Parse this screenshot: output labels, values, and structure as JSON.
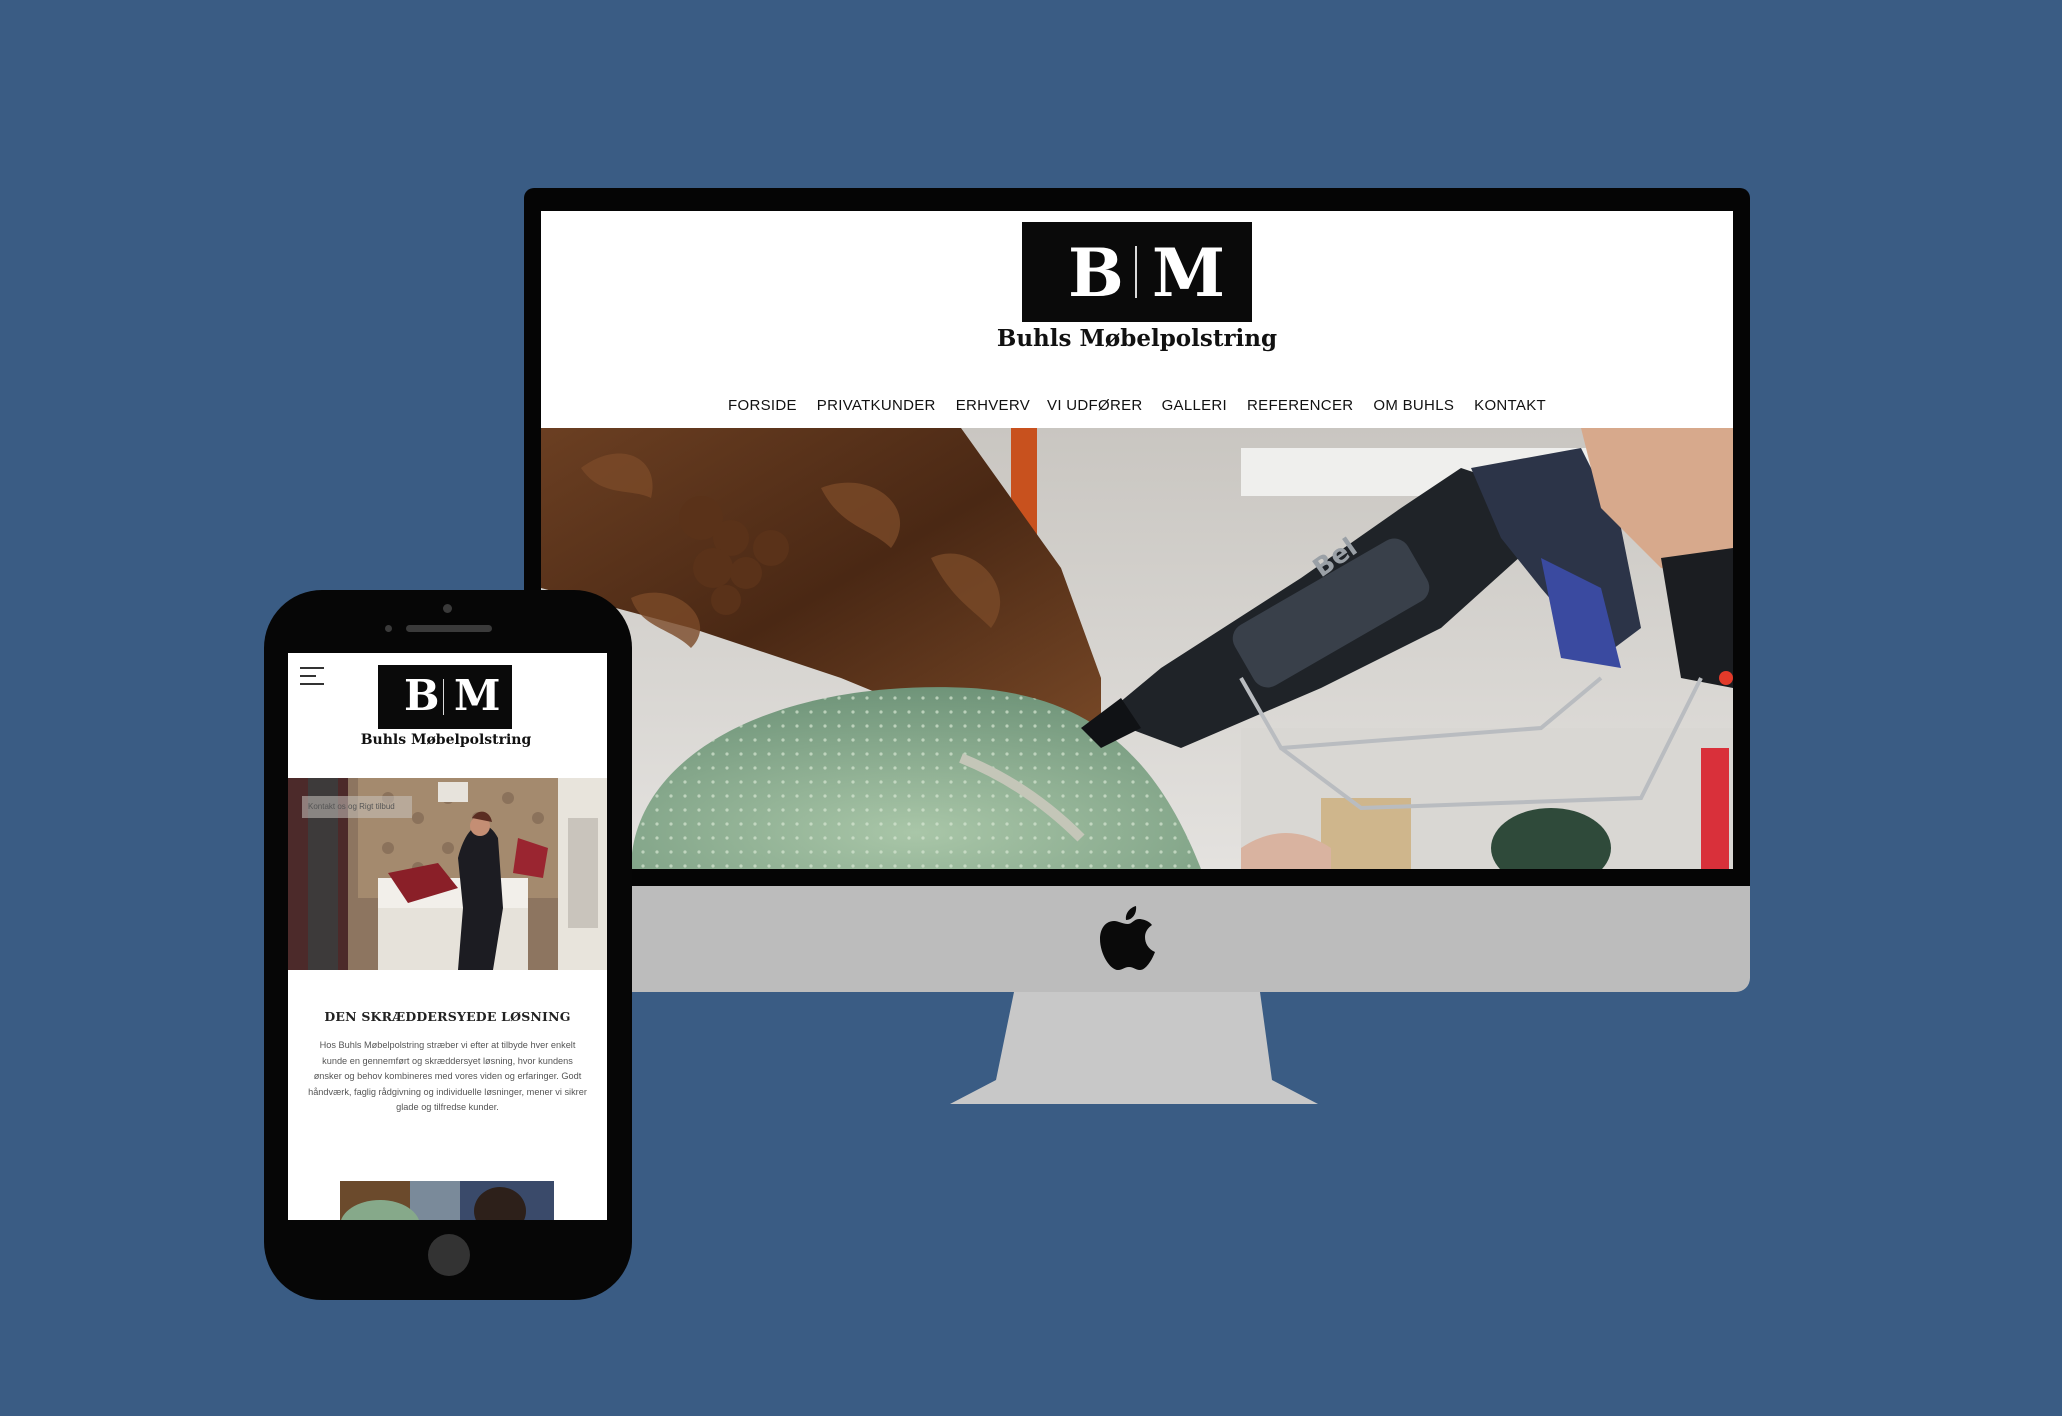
{
  "colors": {
    "background": "#3a5c84",
    "device_black": "#050505",
    "monitor_silver": "#bcbcbc",
    "logo_black": "#0a0a0a"
  },
  "desktop": {
    "logo": {
      "letter_left": "B",
      "letter_right": "M",
      "brand": "Buhls Møbelpolstring"
    },
    "nav": [
      "FORSIDE",
      "PRIVATKUNDER",
      "ERHVERV",
      "VI UDFØRER",
      "GALLERI",
      "REFERENCER",
      "OM BUHLS",
      "KONTAKT"
    ],
    "hero_icon": "glue-gun-photo",
    "hero_brand_text": "Bel"
  },
  "phone": {
    "menu_icon": "hamburger-menu-icon",
    "logo": {
      "letter_left": "B",
      "letter_right": "M",
      "brand": "Buhls Møbelpolstring"
    },
    "hero_caption": "Kontakt os og Rigt tilbud",
    "heading": "DEN SKRÆDDERSYEDE LØSNING",
    "paragraph": "Hos Buhls Møbelpolstring stræber vi efter at tilbyde hver enkelt kunde en gennemført og skræddersyet løsning, hvor kundens ønsker og behov kombineres med vores viden og erfaringer. Godt håndværk, faglig rådgivning og individuelle løsninger, mener vi sikrer glade og tilfredse kunder."
  }
}
